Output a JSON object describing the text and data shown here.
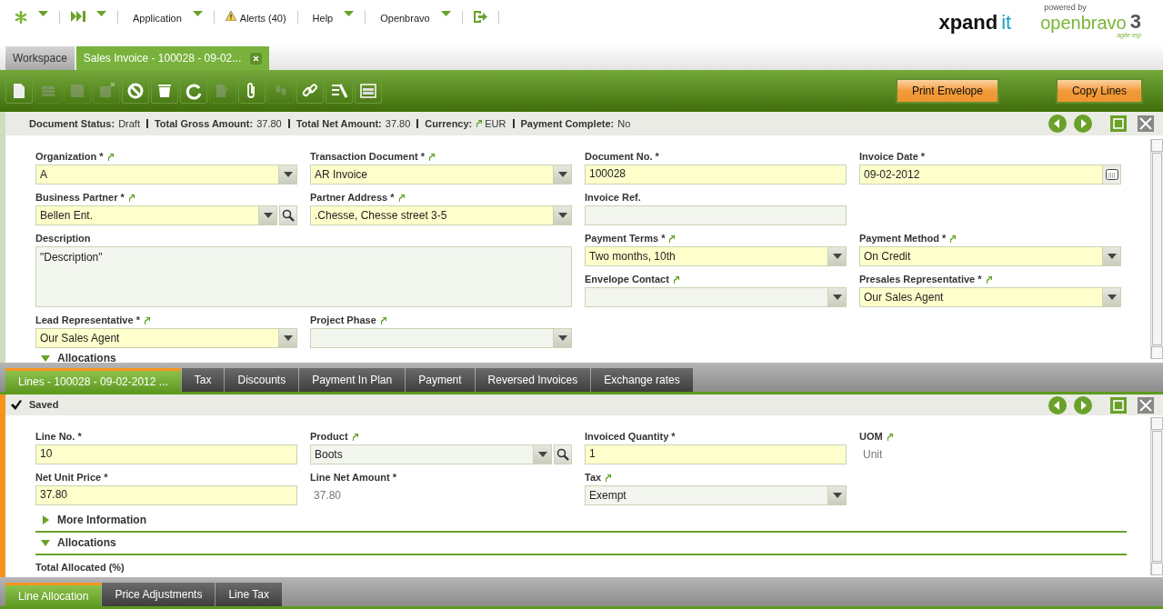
{
  "nav": [
    {
      "kind": "quick"
    },
    {
      "kind": "menu",
      "label": "Application"
    },
    {
      "kind": "alert",
      "label": "Alerts (40)"
    },
    {
      "kind": "menu",
      "label": "Help"
    },
    {
      "kind": "menu",
      "label": "Openbravo"
    }
  ],
  "logos": {
    "xpand": "xpand",
    "it": "it",
    "powered": "powered by",
    "openbravo": "openbravo",
    "version": "3",
    "tagline": "agile erp"
  },
  "window_tabs": [
    {
      "label": "Workspace",
      "selected": false,
      "closable": false
    },
    {
      "label": "Sales Invoice - 100028 - 09-02...",
      "selected": true,
      "closable": true
    }
  ],
  "toolbar": {
    "buttons": [
      {
        "disabled": false
      },
      {
        "disabled": true
      },
      {
        "disabled": true
      },
      {
        "disabled": true
      },
      {
        "disabled": false
      },
      {
        "disabled": false
      },
      {
        "disabled": false
      },
      {
        "disabled": true
      },
      {
        "disabled": false
      },
      {
        "disabled": true
      },
      {
        "disabled": false
      },
      {
        "disabled": false
      },
      {
        "disabled": false
      }
    ],
    "actions": [
      "Print Envelope",
      "Copy Lines"
    ]
  },
  "status_bar": [
    {
      "label": "Document Status:",
      "value": "Draft",
      "link": false
    },
    {
      "label": "Total Gross Amount:",
      "value": "37.80",
      "link": false
    },
    {
      "label": "Total Net Amount:",
      "value": "37.80",
      "link": false
    },
    {
      "label": "Currency:",
      "value": "EUR",
      "link": true
    },
    {
      "label": "Payment Complete:",
      "value": "No",
      "link": false
    }
  ],
  "header_form": {
    "fields": [
      {
        "label": "Organization *",
        "kind": "combo",
        "value": "A",
        "required": true,
        "link": true
      },
      {
        "label": "Transaction Document *",
        "kind": "combo",
        "value": "AR Invoice",
        "required": true,
        "link": true
      },
      {
        "label": "Document No. *",
        "kind": "text",
        "value": "100028",
        "required": true,
        "link": false
      },
      {
        "label": "Invoice Date *",
        "kind": "date",
        "value": "09-02-2012",
        "required": true,
        "link": false
      },
      {
        "label": "Business Partner *",
        "kind": "search",
        "value": "Bellen Ent.",
        "required": true,
        "link": true
      },
      {
        "label": "Partner Address *",
        "kind": "combo",
        "value": ".Chesse, Chesse street 3-5",
        "required": true,
        "link": true
      },
      {
        "label": "Invoice Ref.",
        "kind": "text",
        "required": false,
        "link": false
      },
      {
        "label": "Description",
        "kind": "textarea",
        "value": "\"Description\"",
        "required": false,
        "link": false
      },
      {
        "label": "Payment Terms *",
        "kind": "combo",
        "value": "Two months, 10th",
        "required": true,
        "link": true
      },
      {
        "label": "Payment Method *",
        "kind": "combo",
        "value": "On Credit",
        "required": true,
        "link": true
      },
      {
        "label": "Envelope Contact",
        "kind": "combo",
        "required": false,
        "link": true
      },
      {
        "label": "Presales Representative *",
        "kind": "combo",
        "value": "Our Sales Agent",
        "required": true,
        "link": true
      },
      {
        "label": "Lead Representative *",
        "kind": "combo",
        "value": "Our Sales Agent",
        "required": true,
        "link": true
      },
      {
        "label": "Project Phase",
        "kind": "combo",
        "required": false,
        "link": true
      }
    ],
    "sections": [
      {
        "label": "Allocations",
        "expanded": true
      }
    ]
  },
  "child_tabs": [
    {
      "label": "Lines - 100028 - 09-02-2012 ...",
      "selected": true
    },
    {
      "label": "Tax",
      "selected": false
    },
    {
      "label": "Discounts",
      "selected": false
    },
    {
      "label": "Payment In Plan",
      "selected": false
    },
    {
      "label": "Payment",
      "selected": false
    },
    {
      "label": "Reversed Invoices",
      "selected": false
    },
    {
      "label": "Exchange rates",
      "selected": false
    }
  ],
  "lines_panel": {
    "message": "Saved",
    "saved": true,
    "fields": [
      {
        "label": "Line No. *",
        "kind": "text",
        "value": "10",
        "required": true,
        "link": false
      },
      {
        "label": "Product",
        "kind": "search",
        "value": "Boots",
        "required": false,
        "link": true
      },
      {
        "label": "Invoiced Quantity *",
        "kind": "text",
        "value": "1",
        "required": true,
        "link": false
      },
      {
        "label": "UOM",
        "kind": "display",
        "value": "Unit",
        "link": true
      },
      {
        "label": "Net Unit Price *",
        "kind": "text",
        "value": "37.80",
        "required": true,
        "link": false
      },
      {
        "label": "Line Net Amount *",
        "kind": "display",
        "value": "37.80",
        "link": false
      },
      {
        "label": "Tax",
        "kind": "combo",
        "value": "Exempt",
        "required": false,
        "link": true
      }
    ],
    "sections": [
      {
        "label": "More Information",
        "expanded": false
      },
      {
        "label": "Allocations",
        "expanded": true
      }
    ],
    "total_label": "Total Allocated (%)"
  },
  "bottom_tabs": [
    {
      "label": "Line Allocation",
      "selected": true
    },
    {
      "label": "Price Adjustments",
      "selected": false
    },
    {
      "label": "Line Tax",
      "selected": false
    }
  ]
}
